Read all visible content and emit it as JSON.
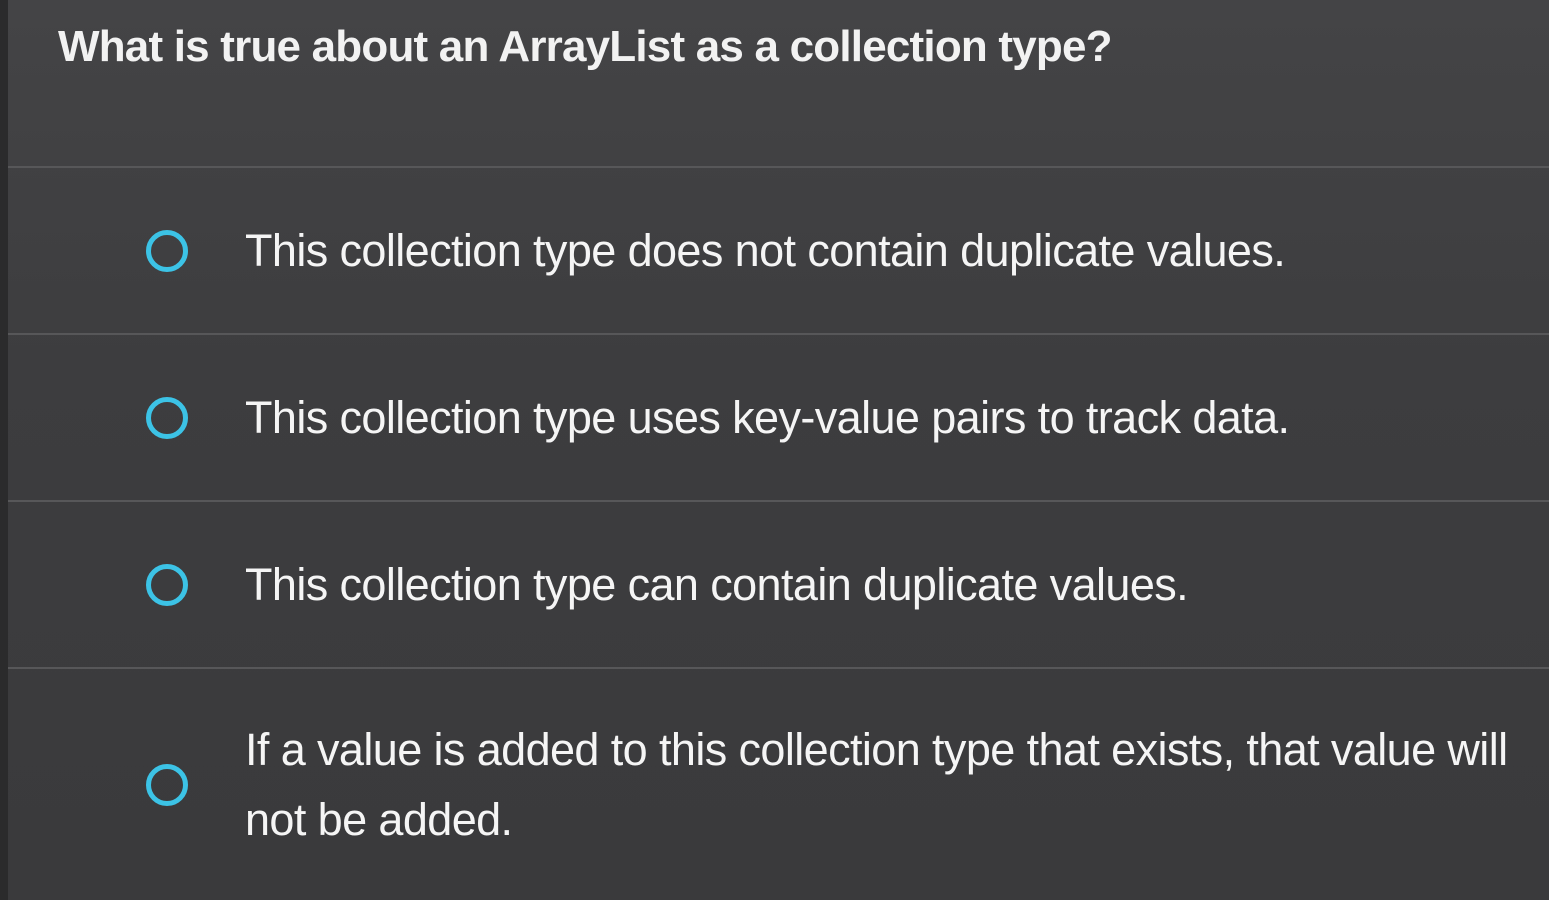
{
  "question": {
    "text": "What is true about an ArrayList as a collection type?"
  },
  "options": [
    {
      "label": "This collection type does not contain duplicate values.",
      "selected": false
    },
    {
      "label": "This collection type uses key-value pairs to track data.",
      "selected": false
    },
    {
      "label": "This collection type can contain duplicate values.",
      "selected": false
    },
    {
      "label": "If a value is added to this collection type that exists, that value will not be added.",
      "selected": false
    }
  ],
  "colors": {
    "background": "#3f3f41",
    "radio_accent": "#3cc3e6",
    "text": "#f5f5f5"
  }
}
